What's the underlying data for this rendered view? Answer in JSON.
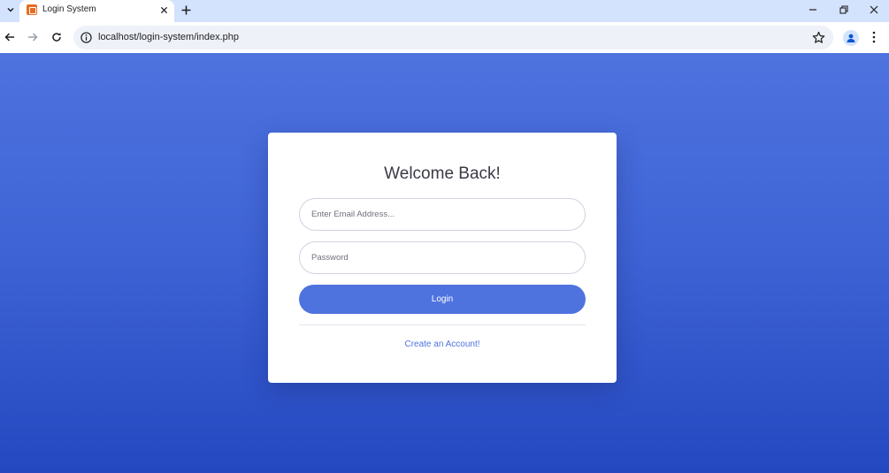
{
  "browser": {
    "tab_title": "Login System",
    "url": "localhost/login-system/index.php"
  },
  "colors": {
    "accent": "#4e73df",
    "tab_favicon": "#e56d23",
    "page_gradient_top": "#4e73df",
    "page_gradient_bottom": "#2448c0"
  },
  "icons": {
    "tab_search": "chevron-down-icon",
    "tab_close": "close-icon",
    "new_tab": "plus-icon",
    "minimize": "minimize-icon",
    "restore": "restore-icon",
    "close_window": "close-icon",
    "back": "arrow-left-icon",
    "forward": "arrow-right-icon",
    "reload": "reload-icon",
    "site_info": "info-icon",
    "bookmark": "star-icon",
    "profile": "profile-icon",
    "menu": "more-vert-icon"
  },
  "login": {
    "title": "Welcome Back!",
    "email_placeholder": "Enter Email Address...",
    "email_value": "",
    "password_placeholder": "Password",
    "password_value": "",
    "login_label": "Login",
    "create_account_label": "Create an Account!"
  }
}
